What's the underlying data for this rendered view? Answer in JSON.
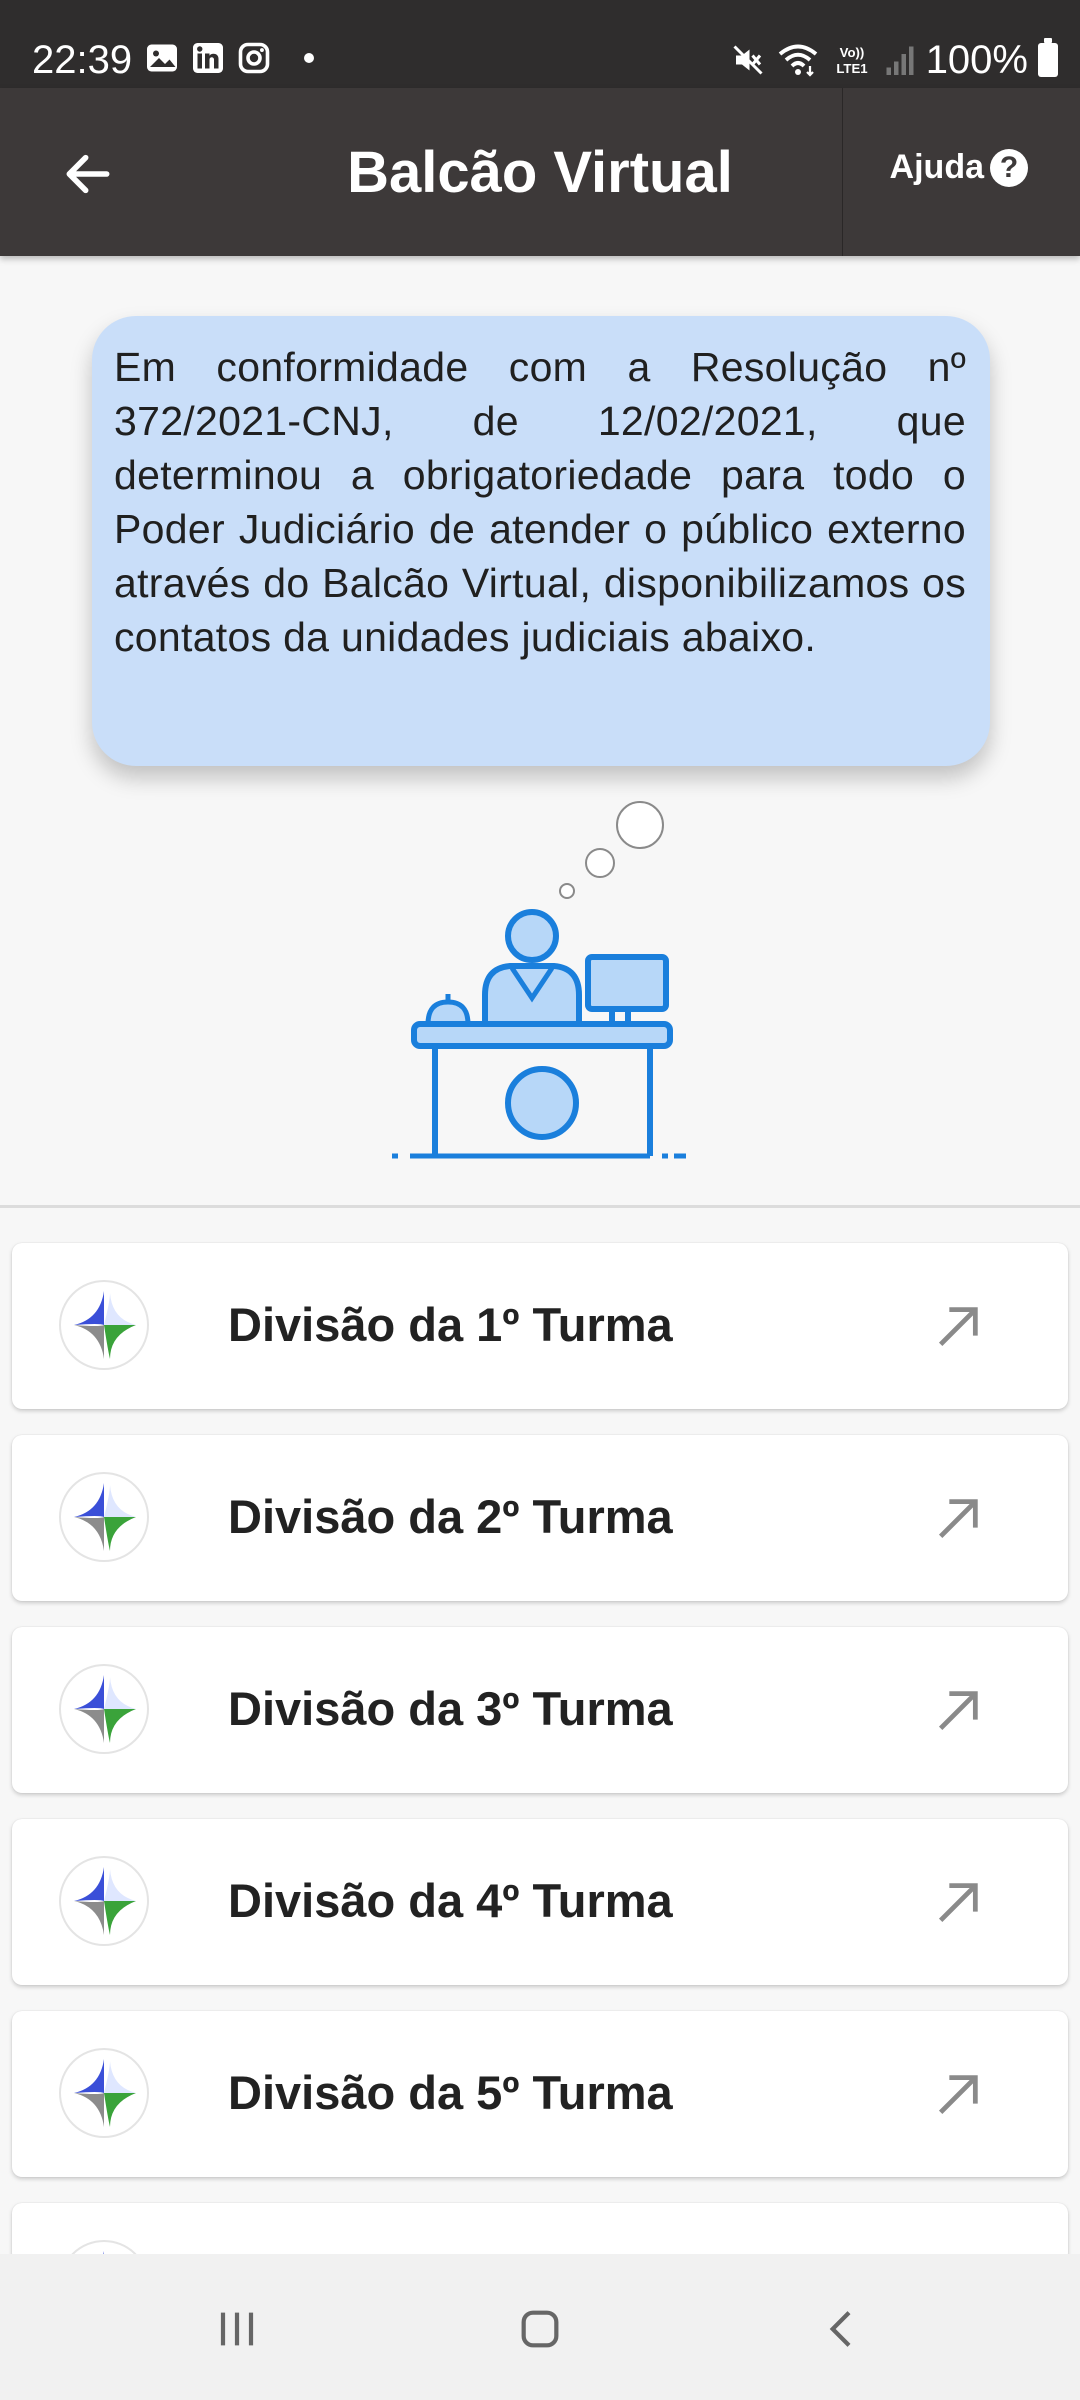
{
  "status_bar": {
    "time": "22:39",
    "battery": "100%",
    "left_icons": [
      "image-icon",
      "linkedin-icon",
      "instagram-icon",
      "dot-icon"
    ],
    "right_icons": [
      "mute-icon",
      "wifi-icon",
      "volte-icon",
      "signal-icon",
      "battery-icon"
    ],
    "volte_text": "Vo)) LTE1"
  },
  "app_bar": {
    "title": "Balcão Virtual",
    "help_label": "Ajuda",
    "help_icon_text": "?"
  },
  "info": {
    "text": "Em conformidade com a Resolução nº 372/2021-CNJ, de 12/02/2021, que determinou a obrigatoriedade para todo o Poder Judiciário de atender o público externo através do Balcão Virtual, disponibilizamos os contatos da unidades judiciais abaixo."
  },
  "colors": {
    "status_bar": "#2f2d2d",
    "app_bar": "#3d3939",
    "bubble": "#c9def9",
    "illustration_blue": "#1a7fdc",
    "illustration_fill": "#b7d7f8",
    "arrow": "#8a8a8a"
  },
  "divisions": [
    {
      "label": "Divisão da 1º Turma"
    },
    {
      "label": "Divisão da 2º Turma"
    },
    {
      "label": "Divisão da 3º Turma"
    },
    {
      "label": "Divisão da 4º Turma"
    },
    {
      "label": "Divisão da 5º Turma"
    }
  ],
  "nav_bar": {
    "buttons": [
      "recents-icon",
      "home-icon",
      "back-icon"
    ]
  }
}
